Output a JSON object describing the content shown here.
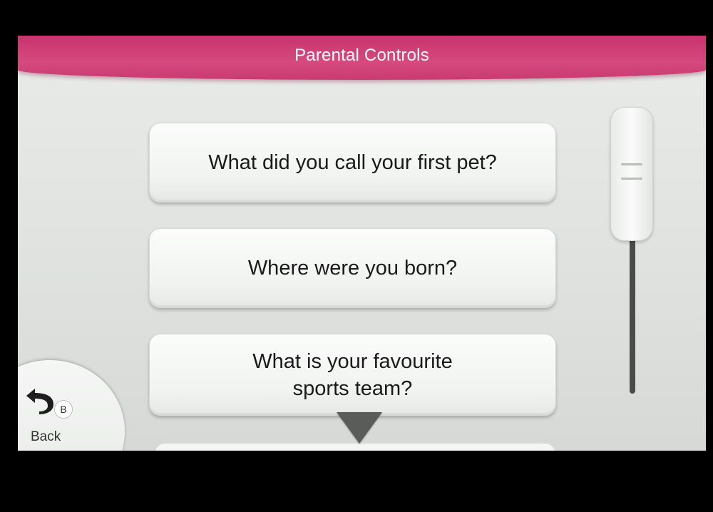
{
  "header": {
    "title": "Parental Controls"
  },
  "questions": [
    "What did you call your first pet?",
    "Where were you born?",
    "What is your favourite\nsports team?"
  ],
  "back": {
    "label": "Back",
    "button_badge": "B"
  },
  "colors": {
    "header": "#c8336c",
    "background": "#e2e5e2",
    "card": "#f5f6f5",
    "text": "#1a1a1a"
  },
  "icons": {
    "back": "back-arrow-icon",
    "scroll_more": "scroll-down-arrow-icon"
  }
}
